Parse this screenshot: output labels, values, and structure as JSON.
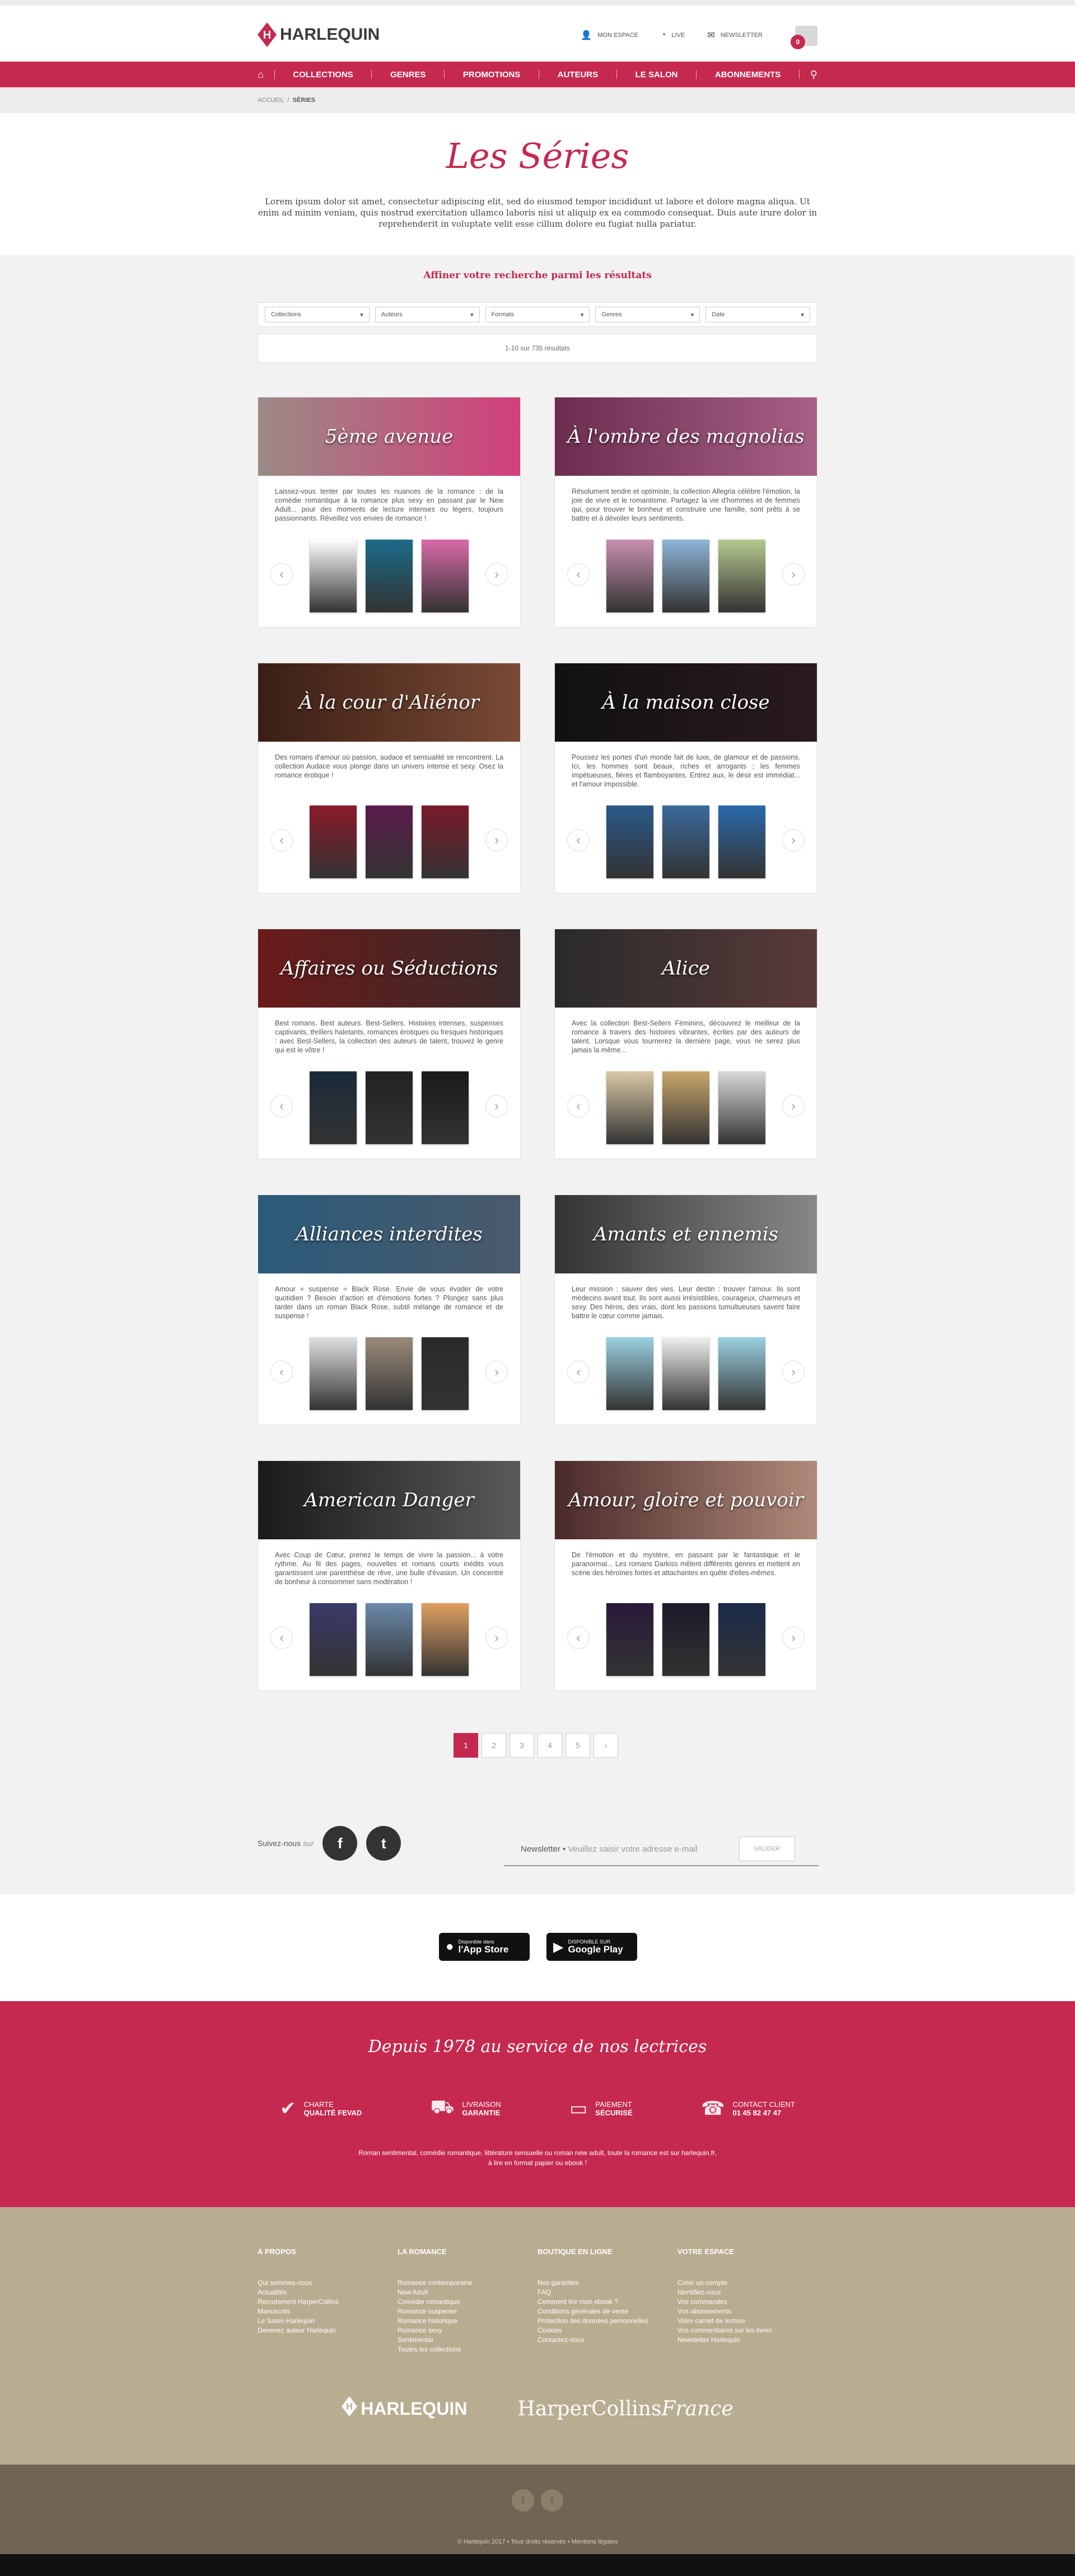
{
  "header": {
    "logo_text": "HARLEQUIN",
    "links": [
      {
        "label": "MON ESPACE",
        "icon": "user-icon"
      },
      {
        "label": "LIVE",
        "icon": "live-icon"
      },
      {
        "label": "NEWSLETTER",
        "icon": "mail-icon"
      }
    ],
    "cart_count": "0"
  },
  "nav": {
    "items": [
      "COLLECTIONS",
      "GENRES",
      "PROMOTIONS",
      "AUTEURS",
      "LE SALON",
      "ABONNEMENTS"
    ]
  },
  "breadcrumb": {
    "home": "ACCUEIL",
    "sep": "/",
    "current": "SÉRIES"
  },
  "hero": {
    "title": "Les Séries",
    "text": "Lorem ipsum dolor sit amet, consectetur adipiscing elit, sed do eiusmod tempor incididunt ut labore et dolore magna aliqua. Ut enim ad minim veniam, quis nostrud exercitation ullamco laboris nisi ut aliquip ex ea commodo consequat. Duis aute irure dolor in reprehenderit in voluptate velit esse cillum dolore eu fugiat nulla pariatur."
  },
  "filters": {
    "title": "Affiner votre recherche parmi les résultats",
    "options": [
      "Collections",
      "Auteurs",
      "Formats",
      "Genres",
      "Date"
    ],
    "results": "1-10 sur 735 résultats"
  },
  "cards": [
    {
      "title": "5ème avenue",
      "desc": "Laissez-vous tenter par toutes les nuances de la romance : de la comédie romantique à la romance plus sexy en passant par le New Adult... pour des moments de lecture intenses ou légers, toujours passionnants. Réveillez vos envies de romance !",
      "colors": [
        "#9b8a86",
        "#d23f7a"
      ],
      "books": [
        "#ffffff",
        "#1a6b8a",
        "#d96aa8"
      ]
    },
    {
      "title": "À l'ombre des magnolias",
      "desc": "Résolument tendre et optimiste, la collection Allegria célèbre l'émotion, la joie de vivre et le romantisme. Partagez la vie d'hommes et de femmes qui, pour trouver le bonheur et construire une famille, sont prêts à se battre et à dévoiler leurs sentiments.",
      "colors": [
        "#6b2d4f",
        "#a85f86"
      ],
      "books": [
        "#c98fb0",
        "#8fb6d9",
        "#b6c98f"
      ]
    },
    {
      "title": "À la cour d'Aliénor",
      "desc": "Des romans d'amour où passion, audace et sensualité se rencontrent. La collection Audace vous plonge dans un univers intense et sexy. Osez la romance érotique !",
      "colors": [
        "#3a1e14",
        "#7a4a36"
      ],
      "books": [
        "#8a1a2a",
        "#5a1a4a",
        "#7a1a2a"
      ]
    },
    {
      "title": "À la maison close",
      "desc": "Poussez les portes d'un monde fait de luxe, de glamour et de passions. Ici, les hommes sont beaux, riches et arrogants ; les femmes impétueuses, fières et flamboyantes. Entrez aux, le désir est immédiat... et l'amour impossible.",
      "colors": [
        "#111111",
        "#2a1a20"
      ],
      "books": [
        "#2a5a8a",
        "#3a6a9a",
        "#2a6aaa"
      ]
    },
    {
      "title": "Affaires ou Séductions",
      "desc": "Best romans. Best auteurs. Best-Sellers. Histoires intenses, suspenses captivants, thrillers haletants, romances érotiques ou fresques historiques : avec Best-Sellers, la collection des auteurs de talent, trouvez le genre qui est le vôtre !",
      "colors": [
        "#6a1a1a",
        "#3a2a2a"
      ],
      "books": [
        "#1a2a3a",
        "#222222",
        "#1a1a1a"
      ]
    },
    {
      "title": "Alice",
      "desc": "Avec la collection Best-Sellers Féminins, découvrez le meilleur de la romance à travers des histoires vibrantes, écrites par des auteurs de talent. Lorsque vous tournerez la dernière page, vous ne serez plus jamais la même...",
      "colors": [
        "#2a2a2a",
        "#5a3a3a"
      ],
      "books": [
        "#d9c9a6",
        "#c9a66a",
        "#d9d9d9"
      ]
    },
    {
      "title": "Alliances interdites",
      "desc": "Amour + suspense = Black Rose. Envie de vous évader de votre quotidien ? Besoin d'action et d'émotions fortes ? Plongez sans plus tarder dans un roman Black Rose, subtil mélange de romance et de suspense !",
      "colors": [
        "#2a5a7a",
        "#4a5a6a"
      ],
      "books": [
        "#e0e0e0",
        "#9a8a7a",
        "#2a2a2a"
      ]
    },
    {
      "title": "Amants et ennemis",
      "desc": "Leur mission : sauver des vies. Leur destin : trouver l'amour. Ils sont médecins avant tout. Ils sont aussi irrésistibles, courageux, charmeurs et sexy. Des héros, des vrais, dont les passions tumultueuses savent faire battre le cœur comme jamais.",
      "colors": [
        "#333333",
        "#888888"
      ],
      "books": [
        "#9ad0e0",
        "#f0f0f0",
        "#9ad0e0"
      ]
    },
    {
      "title": "American Danger",
      "desc": "Avec Coup de Cœur, prenez le temps de vivre la passion... à votre rythme. Au fil des pages, nouvelles et romans courts inédits vous garantissent une parenthèse de rêve, une bulle d'évasion. Un concentré de bonheur à consommer sans modération !",
      "colors": [
        "#1a1a1a",
        "#5a5a5a"
      ],
      "books": [
        "#3a3a6a",
        "#6a8aaa",
        "#e0a060"
      ]
    },
    {
      "title": "Amour, gloire et pouvoir",
      "desc": "De l'émotion et du mystère, en passant par le fantastique et le paranormal... Les romans Darkiss mêlent différents genres et mettent en scène des héroïnes fortes et attachantes en quête d'elles-mêmes.",
      "colors": [
        "#4a2a2a",
        "#b08a7a"
      ],
      "books": [
        "#2a1a3a",
        "#1a1a2a",
        "#1a2a4a"
      ]
    }
  ],
  "pagination": {
    "pages": [
      "1",
      "2",
      "3",
      "4",
      "5",
      "›"
    ]
  },
  "social": {
    "follow": "Suivez-nous",
    "sur": "sur",
    "facebook": "f",
    "twitter": "t"
  },
  "newsletter": {
    "label": "Newsletter",
    "placeholder": "Veuillez saisir votre adresse e-mail",
    "button": "VALIDER"
  },
  "apps": {
    "appstore_small": "Disponible dans",
    "appstore_big": "l'App Store",
    "googleplay_small": "DISPONIBLE SUR",
    "googleplay_big": "Google Play"
  },
  "footer_red": {
    "title": "Depuis 1978 au service de nos lectrices",
    "services": [
      {
        "t1": "CHARTE",
        "t2": "QUALITÉ FEVAD",
        "icon": "check-icon"
      },
      {
        "t1": "LIVRAISON",
        "t2": "GARANTIE",
        "icon": "truck-icon"
      },
      {
        "t1": "PAIEMENT",
        "t2": "SÉCURISÉ",
        "icon": "card-icon"
      },
      {
        "t1": "CONTACT CLIENT",
        "t2": "01 45 82 47 47",
        "icon": "phone-icon"
      }
    ],
    "text1": "Roman sentimental, comédie romantique, littérature sensuelle ou roman new adult, toute la romance est sur harlequin.fr,",
    "text2": "à lire en format papier ou ebook !"
  },
  "footer_beige": {
    "columns": [
      {
        "title": "À PROPOS",
        "links": [
          "Qui sommes-nous",
          "Actualités",
          "Recrutement HarperCollins",
          "Manuscrits",
          "Le Salon Harlequin",
          "Devenez auteur Harlequin"
        ]
      },
      {
        "title": "LA ROMANCE",
        "links": [
          "Romance contemporaine",
          "New Adult",
          "Comédie romantique",
          "Romance suspense",
          "Romance historique",
          "Romance sexy",
          "Sentimental",
          "Toutes les collections"
        ]
      },
      {
        "title": "BOUTIQUE EN LIGNE",
        "links": [
          "Nos garanties",
          "FAQ",
          "Comment lire mon ebook ?",
          "Conditions générales de vente",
          "Protection des données personnelles",
          "Cookies",
          "Contactez-nous"
        ]
      },
      {
        "title": "VOTRE ESPACE",
        "links": [
          "Créer un compte",
          "Identifiez-vous",
          "Vos commandes",
          "Vos abonnements",
          "Votre carnet de lecture",
          "Vos commentaires sur les livres",
          "Newsletter Harlequin"
        ]
      }
    ],
    "brand1": "HARLEQUIN",
    "brand2a": "HarperCollins",
    "brand2b": "France"
  },
  "footer_dark": {
    "copyright": "© Harlequin 2017 • Tous droits réservés • Mentions légales",
    "f": "f",
    "t": "t"
  }
}
